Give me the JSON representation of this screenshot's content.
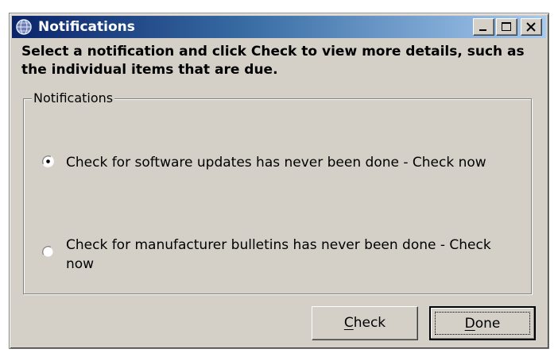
{
  "window": {
    "title": "Notifications",
    "icon": "notification-globe-icon",
    "controls": [
      "minimize-icon",
      "maximize-icon",
      "close-icon"
    ]
  },
  "instructions": "Select a notification and click Check to view more details, such as the individual items that are due.",
  "notifications_group": {
    "legend": "Notifications",
    "options": [
      {
        "label": "Check for software updates has never been done - Check now",
        "selected": true
      },
      {
        "label": "Check for manufacturer bulletins has never been done - Check now",
        "selected": false
      }
    ]
  },
  "buttons": {
    "check": {
      "mnemonic": "C",
      "rest": "heck"
    },
    "done": {
      "mnemonic": "D",
      "rest": "one"
    }
  },
  "colors": {
    "title_gradient_start": "#0a246a",
    "title_gradient_end": "#a6caf0",
    "face": "#d4d0c8"
  }
}
